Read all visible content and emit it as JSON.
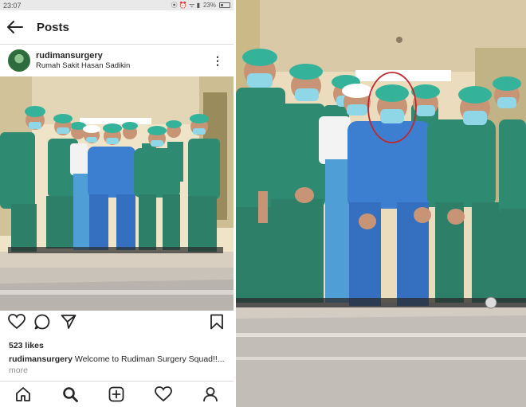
{
  "status_bar": {
    "time": "23:07",
    "icons": "⦿ ⏰ ᯤ ▮",
    "battery": "23%"
  },
  "header": {
    "back_icon": "arrow-left-icon",
    "title": "Posts"
  },
  "post": {
    "username": "rudimansurgery",
    "location": "Rumah Sakit Hasan Sadikin",
    "more_icon": "⋮",
    "likes": "523 likes",
    "caption_user": "rudimansurgery",
    "caption_text": " Welcome to Rudiman Surgery Squad!!...",
    "caption_more": " more"
  },
  "actions": [
    "heart-icon",
    "comment-icon",
    "share-icon",
    "bookmark-icon"
  ],
  "bottom_nav": [
    "home-icon",
    "search-icon",
    "add-icon",
    "activity-icon",
    "profile-icon"
  ],
  "colors": {
    "scrub_green": "#2f8a72",
    "scrub_blue": "#3c7fd0",
    "cap": "#35b39a",
    "mask": "#8fd6e6",
    "highlight_circle": "#c0282f"
  }
}
